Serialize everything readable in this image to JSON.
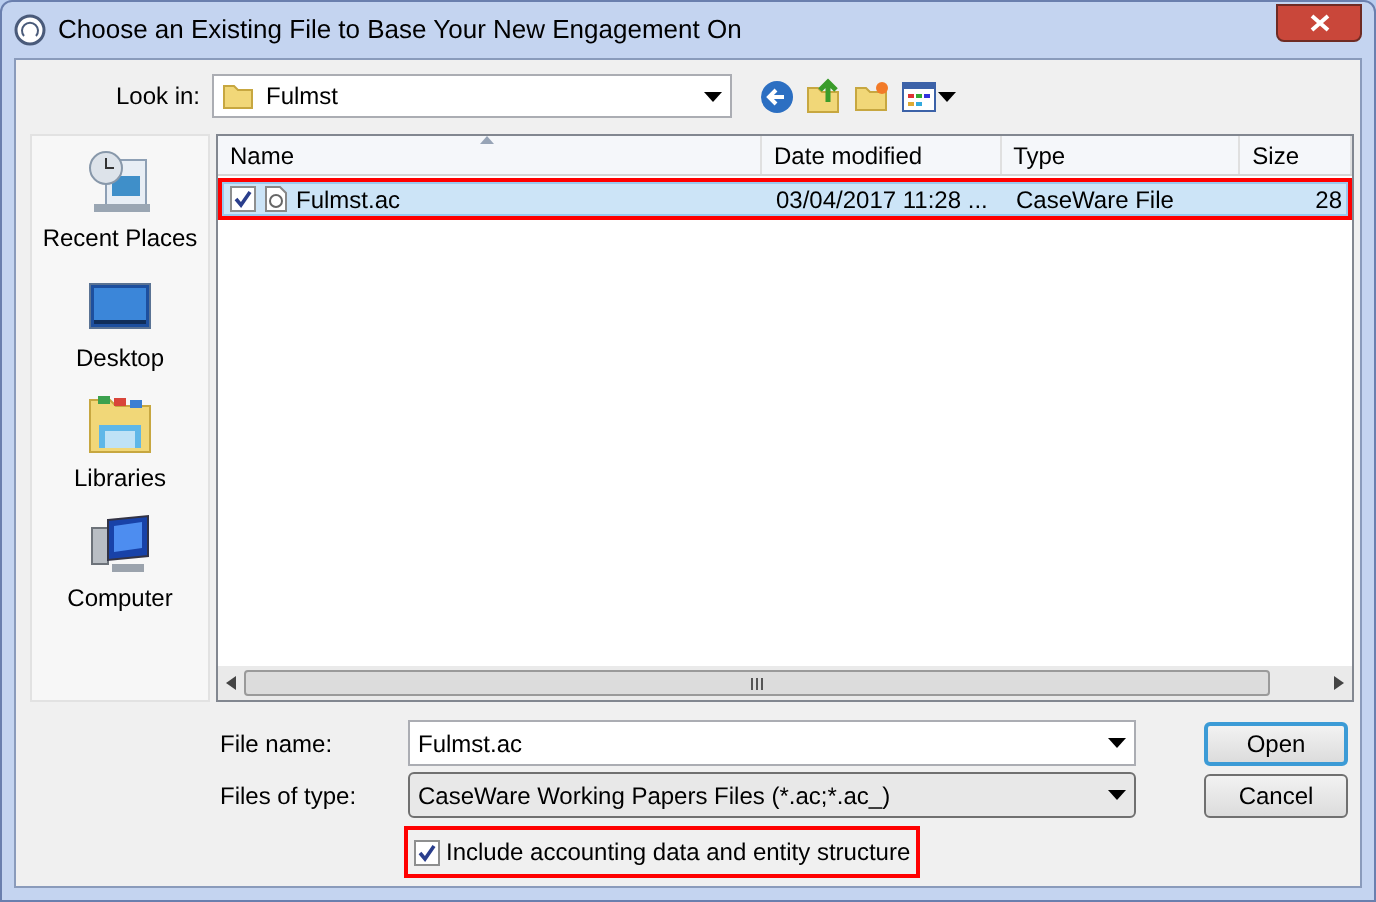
{
  "window": {
    "title": "Choose an Existing File to Base Your New Engagement On"
  },
  "look_in": {
    "label": "Look in:",
    "value": "Fulmst"
  },
  "places": [
    {
      "label": "Recent Places",
      "kind": "recent"
    },
    {
      "label": "Desktop",
      "kind": "desktop"
    },
    {
      "label": "Libraries",
      "kind": "libraries"
    },
    {
      "label": "Computer",
      "kind": "computer"
    }
  ],
  "table": {
    "columns": [
      "Name",
      "Date modified",
      "Type",
      "Size"
    ],
    "rows": [
      {
        "name": "Fulmst.ac",
        "date": "03/04/2017 11:28 ...",
        "type": "CaseWare File",
        "size": "28",
        "selected": true,
        "checked": true,
        "highlighted": true
      }
    ]
  },
  "file_name": {
    "label": "File name:",
    "value": "Fulmst.ac"
  },
  "file_type": {
    "label": "Files of type:",
    "value": "CaseWare Working Papers Files (*.ac;*.ac_)"
  },
  "include_option": {
    "label": "Include accounting data and entity structure",
    "checked": true,
    "highlighted": true
  },
  "buttons": [
    {
      "label": "Open",
      "default": true
    },
    {
      "label": "Cancel",
      "default": false
    }
  ]
}
